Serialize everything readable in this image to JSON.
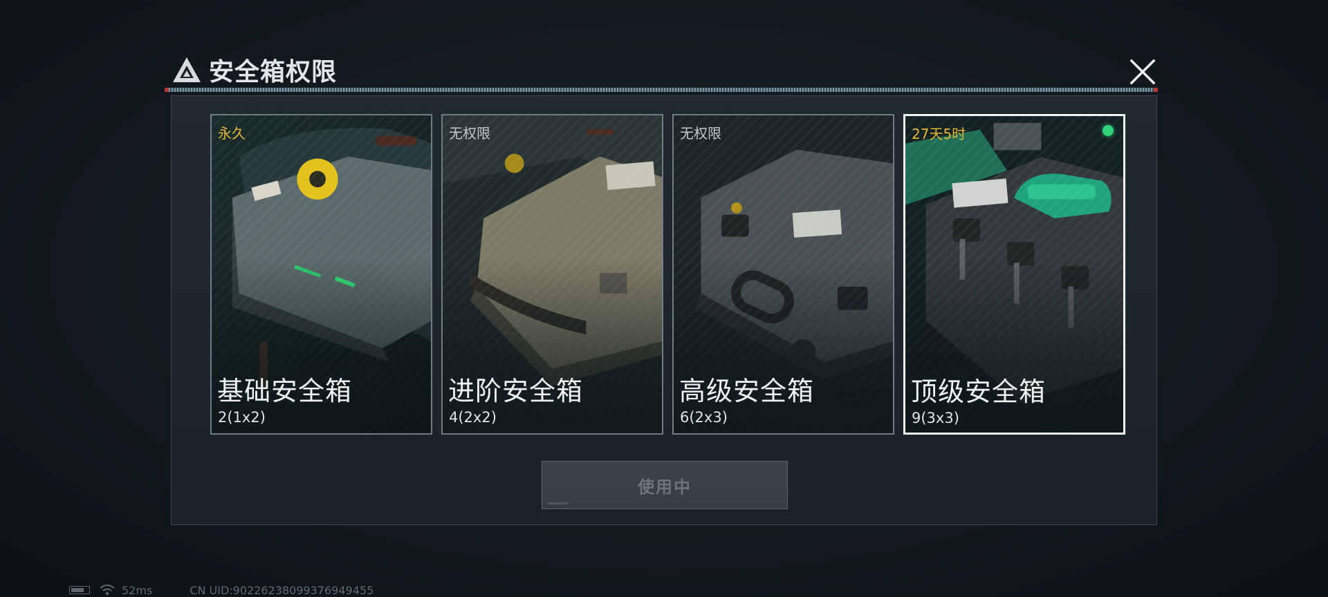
{
  "dialog": {
    "title": "安全箱权限",
    "title_icon": "warning-triangle-logo-icon",
    "close_icon": "close-icon"
  },
  "cards": [
    {
      "status": "永久",
      "status_color": "#e6b83a",
      "name": "基础安全箱",
      "capacity": "2(1x2)",
      "selected": false
    },
    {
      "status": "无权限",
      "status_color": "#c4c9cb",
      "name": "进阶安全箱",
      "capacity": "4(2x2)",
      "selected": false
    },
    {
      "status": "无权限",
      "status_color": "#c4c9cb",
      "name": "高级安全箱",
      "capacity": "6(2x3)",
      "selected": false
    },
    {
      "status": "27天5时",
      "status_color": "#e6b83a",
      "name": "顶级安全箱",
      "capacity": "9(3x3)",
      "selected": true,
      "indicator_color": "#2fd279"
    }
  ],
  "use_button": {
    "label": "使用中",
    "enabled": false
  },
  "footer": {
    "battery_icon": "battery-icon",
    "wifi_icon": "wifi-icon",
    "ping": "52ms",
    "uid": "CN UID:9022623809937694945​5"
  },
  "colors": {
    "accent_gold": "#e6b83a",
    "active_green": "#2fd279",
    "panel_bg": "#1f2a31"
  }
}
